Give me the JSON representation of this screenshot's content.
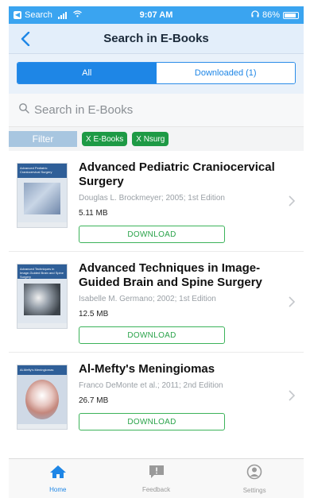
{
  "status": {
    "carrier": "Search",
    "time": "9:07 AM",
    "battery": "86%"
  },
  "nav": {
    "title": "Search in E-Books"
  },
  "segments": {
    "all": "All",
    "downloaded": "Downloaded (1)"
  },
  "search": {
    "placeholder": "Search in E-Books"
  },
  "filter": {
    "label": "Filter",
    "chips": [
      "X E-Books",
      "X Nsurg"
    ]
  },
  "books": [
    {
      "title": "Advanced Pediatric Craniocervical Surgery",
      "meta": "Douglas L. Brockmeyer; 2005; 1st Edition",
      "size": "5.11 MB",
      "download": "DOWNLOAD",
      "cover_color": "#2f5f98"
    },
    {
      "title": "Advanced Techniques in Image-Guided Brain and Spine Surgery",
      "meta": "Isabelle M. Germano; 2002; 1st Edition",
      "size": "12.5 MB",
      "download": "DOWNLOAD",
      "cover_color": "#2f5f98"
    },
    {
      "title": "Al-Mefty's Meningiomas",
      "meta": "Franco DeMonte et al.; 2011; 2nd Edition",
      "size": "26.7 MB",
      "download": "DOWNLOAD",
      "cover_color": "#2f5f98"
    }
  ],
  "tabs": [
    {
      "label": "Home",
      "icon": "home-icon"
    },
    {
      "label": "Feedback",
      "icon": "feedback-icon"
    },
    {
      "label": "Settings",
      "icon": "settings-icon"
    }
  ],
  "colors": {
    "accent": "#1e86e6",
    "download_green": "#2aa34a",
    "chip_green": "#1e9a45"
  }
}
